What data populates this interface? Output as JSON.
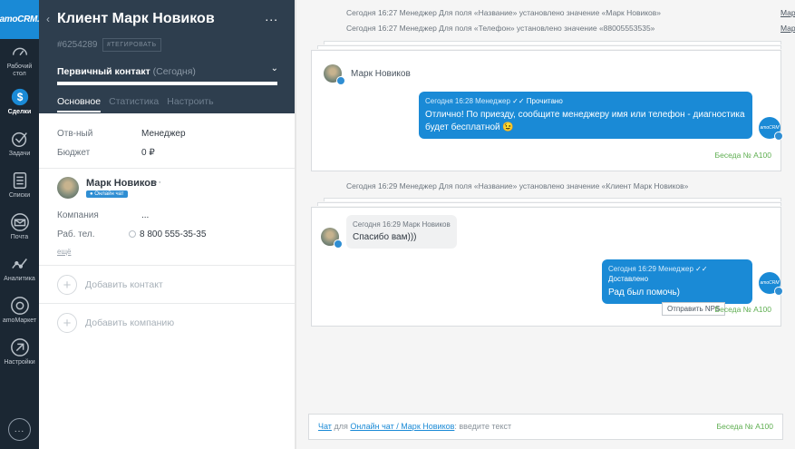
{
  "nav": {
    "logo": "amoCRM.",
    "items": [
      {
        "label": "Рабочий стол",
        "icon": "speedometer-icon",
        "active": false
      },
      {
        "label": "Сделки",
        "icon": "dollar-icon",
        "active": true
      },
      {
        "label": "Задачи",
        "icon": "check-icon",
        "active": false
      },
      {
        "label": "Списки",
        "icon": "list-icon",
        "active": false
      },
      {
        "label": "Почта",
        "icon": "mail-icon",
        "active": false
      },
      {
        "label": "Аналитика",
        "icon": "analytics-icon",
        "active": false
      },
      {
        "label": "amoМаркет",
        "icon": "market-icon",
        "active": false
      },
      {
        "label": "Настройки",
        "icon": "gear-icon",
        "active": false
      }
    ],
    "chat_button": "..."
  },
  "card": {
    "title": "Клиент Марк Новиков",
    "menu": "...",
    "lead_id": "#6254289",
    "tag_button": "#ТЕГИРОВАТЬ",
    "stage": "Первичный контакт",
    "stage_date": "(Сегодня)",
    "progress": 1.0,
    "tabs": [
      "Основное",
      "Статистика",
      "Настроить"
    ],
    "fields": [
      {
        "key": "Отв-ный",
        "value": "Менеджер"
      },
      {
        "key": "Бюджет",
        "value": "0 ₽"
      }
    ],
    "contact": {
      "name": "Марк Новиков",
      "menu": "···",
      "badge": "Онлайн чат",
      "company_label": "Компания",
      "company_value": "...",
      "phone_label": "Раб. тел.",
      "phone_value": "8 800 555-35-35",
      "more": "ещё"
    },
    "add_contact": "Добавить контакт",
    "add_company": "Добавить компанию"
  },
  "feed": {
    "notes_top": [
      {
        "text": "Сегодня 16:27 Менеджер Для поля «Название» установлено значение «Марк Новиков»",
        "author": "Марк Новиков"
      },
      {
        "text": "Сегодня 16:27 Менеджер Для поля «Телефон» установлено значение «88005553535»",
        "author": "Марк Новиков"
      }
    ],
    "chat1": {
      "contact_name": "Марк Новиков",
      "out_meta": "Сегодня 16:28 Менеджер",
      "out_status": "✓✓ Прочитано",
      "out_text": "Отлично! По приезду, сообщите менеджеру имя или телефон - диагностика будет бесплатной 😉",
      "beseda": "Беседа № А100"
    },
    "note_mid": "Сегодня 16:29 Менеджер Для поля «Название» установлено значение «Клиент Марк Новиков»",
    "chat2": {
      "in_meta": "Сегодня 16:29 Марк Новиков",
      "in_text": "Спасибо вам)))",
      "out_meta": "Сегодня 16:29 Менеджер",
      "out_status": "✓✓ Доставлено",
      "out_text": "Рад был помочь)",
      "nps_button": "Отправить NPS",
      "beseda": "Беседа № А100"
    },
    "composer": {
      "chat_link": "Чат",
      "for": "для",
      "target_link": "Онлайн чат / Марк Новиков",
      "placeholder": ": введите текст",
      "beseda": "Беседа № А100"
    },
    "avatar_label": "amoCRM"
  }
}
